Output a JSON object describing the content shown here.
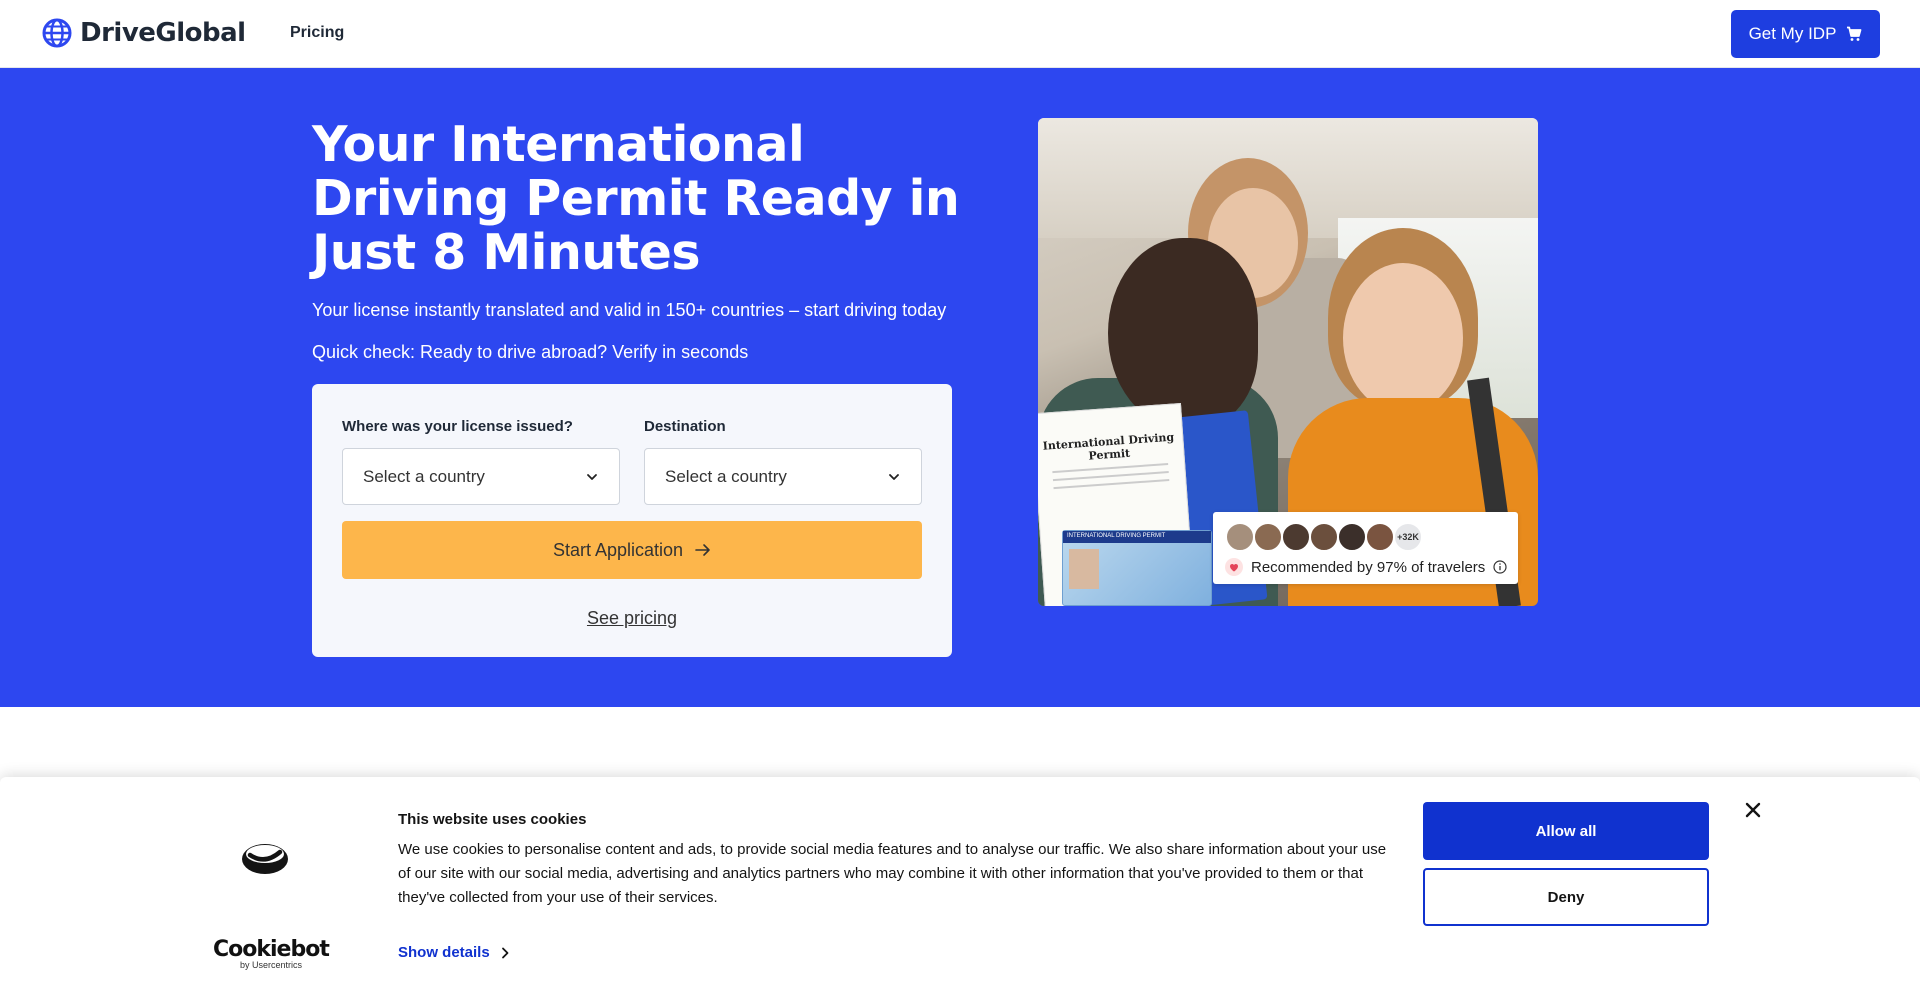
{
  "header": {
    "brand": "DriveGlobal",
    "nav_pricing": "Pricing",
    "cta_label": "Get My IDP"
  },
  "hero": {
    "title": "Your International Driving Permit Ready in Just 8 Minutes",
    "subtitle": "Your license instantly translated and valid in 150+ countries – start driving today",
    "quick_check": "Quick check: Ready to drive abroad? Verify in seconds",
    "form": {
      "issued_label": "Where was your license issued?",
      "issued_value": "Select a country",
      "destination_label": "Destination",
      "destination_value": "Select a country",
      "start_label": "Start Application",
      "see_pricing": "See pricing"
    },
    "image": {
      "permit_title": "International Driving Permit",
      "card_title": "INTERNATIONAL DRIVING PERMIT",
      "avatar_count": "+32K",
      "recommendation": "Recommended by 97% of travelers"
    }
  },
  "cookie": {
    "brand": "Cookiebot",
    "brand_by": "by Usercentrics",
    "title": "This website uses cookies",
    "text": "We use cookies to personalise content and ads, to provide social media features and to analyse our traffic. We also share information about your use of our site with our social media, advertising and analytics partners who may combine it with other information that you've provided to them or that they've collected from your use of their services.",
    "show_details": "Show details",
    "allow_all": "Allow all",
    "deny": "Deny"
  },
  "colors": {
    "hero_bg": "#2d47f0",
    "primary": "#1e3ee0",
    "start_button": "#fdb64b",
    "cookie_primary": "#1032cf"
  },
  "icons": [
    "globe-icon",
    "cart-icon",
    "chevron-down-icon",
    "arrow-right-icon",
    "heart-icon",
    "info-icon",
    "cookiebot-logo-icon",
    "chevron-right-icon",
    "close-icon"
  ]
}
